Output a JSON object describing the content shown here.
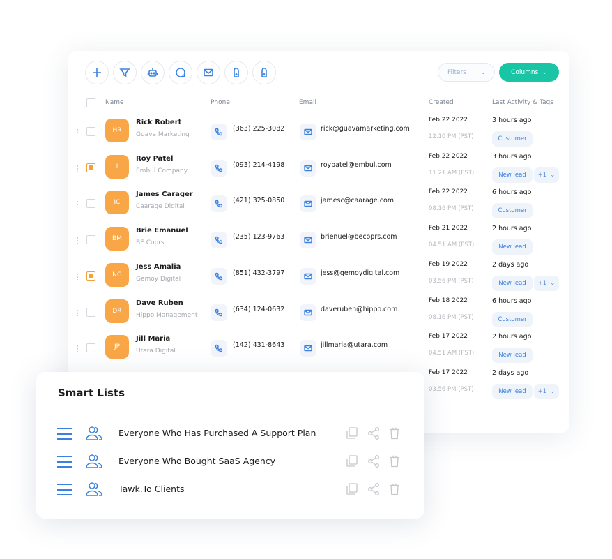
{
  "toolbar": {
    "icons": [
      "plus-icon",
      "filter-icon",
      "robot-icon",
      "chat-icon",
      "mail-icon",
      "tag-add-icon",
      "tag-remove-icon"
    ],
    "filters_label": "Filters",
    "columns_label": "Columns",
    "accent_color": "#19c5a5"
  },
  "table": {
    "headers": {
      "name": "Name",
      "phone": "Phone",
      "email": "Email",
      "created": "Created",
      "activity": "Last Activity & Tags"
    },
    "rows": [
      {
        "initials": "HR",
        "name": "Rick Robert",
        "company": "Guava Marketing",
        "phone": "(363) 225-3082",
        "email": "rick@guavamarketing.com",
        "created": "Feb 22 2022",
        "time": "12.10 PM (PST)",
        "activity": "3 hours ago",
        "tag": "Customer",
        "more": "",
        "checked": false
      },
      {
        "initials": "I",
        "name": "Roy Patel",
        "company": "Embul Company",
        "phone": "(093) 214-4198",
        "email": "roypatel@embul.com",
        "created": "Feb 22 2022",
        "time": "11.21 AM (PST)",
        "activity": "3 hours ago",
        "tag": "New lead",
        "more": "+1",
        "checked": true
      },
      {
        "initials": "IC",
        "name": "James Carager",
        "company": "Caarage Digital",
        "phone": "(421) 325-0850",
        "email": "jamesc@caarage.com",
        "created": "Feb 22 2022",
        "time": "08.16 PM (PST)",
        "activity": "6 hours ago",
        "tag": "Customer",
        "more": "",
        "checked": false
      },
      {
        "initials": "BM",
        "name": "Brie Emanuel",
        "company": "BE Coprs",
        "phone": "(235) 123-9763",
        "email": "brienuel@becoprs.com",
        "created": "Feb 21 2022",
        "time": "04.51 AM (PST)",
        "activity": "2 hours ago",
        "tag": "New lead",
        "more": "",
        "checked": false
      },
      {
        "initials": "NG",
        "name": "Jess Amalia",
        "company": "Gemoy Digital",
        "phone": "(851) 432-3797",
        "email": "jess@gemoydigital.com",
        "created": "Feb 19 2022",
        "time": "03.56 PM (PST)",
        "activity": "2 days ago",
        "tag": "New lead",
        "more": "+1",
        "checked": true
      },
      {
        "initials": "DR",
        "name": "Dave Ruben",
        "company": "Hippo Management",
        "phone": "(634) 124-0632",
        "email": "daveruben@hippo.com",
        "created": "Feb 18 2022",
        "time": "08.16 PM (PST)",
        "activity": "6 hours ago",
        "tag": "Customer",
        "more": "",
        "checked": false
      },
      {
        "initials": "JP",
        "name": "Jill Maria",
        "company": "Utara Digital",
        "phone": "(142) 431-8643",
        "email": "jillmaria@utara.com",
        "created": "Feb 17 2022",
        "time": "04.51 AM (PST)",
        "activity": "2 hours ago",
        "tag": "New lead",
        "more": "",
        "checked": false
      },
      {
        "created": "Feb 17 2022",
        "time": "03.56 PM (PST)",
        "activity": "2 days ago",
        "tag": "New lead",
        "more": "+1"
      }
    ]
  },
  "smart_lists": {
    "title": "Smart Lists",
    "items": [
      {
        "label": "Everyone Who Has Purchased A Support Plan"
      },
      {
        "label": "Everyone Who Bought SaaS Agency"
      },
      {
        "label": "Tawk.To Clients"
      }
    ]
  }
}
